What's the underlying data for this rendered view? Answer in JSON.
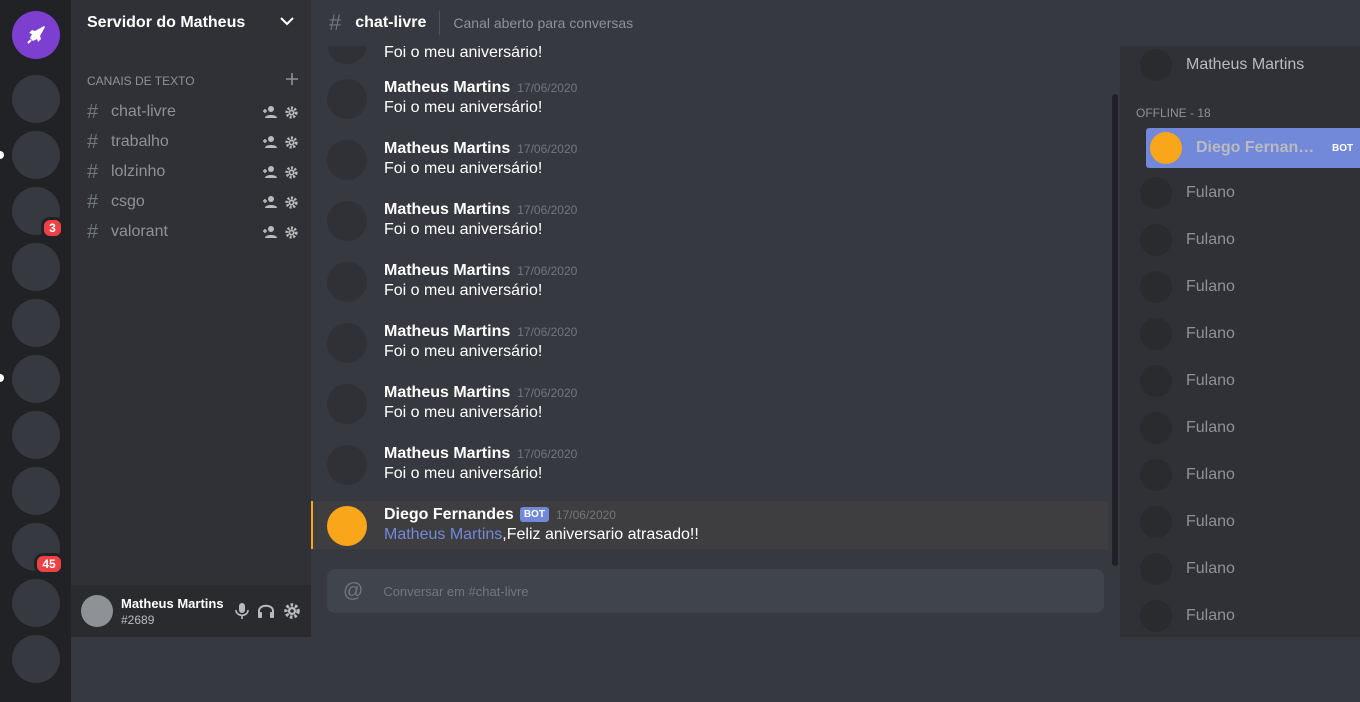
{
  "server": {
    "name": "Servidor do Matheus"
  },
  "sidebar": {
    "category": "CANAIS DE TEXTO",
    "channels": [
      {
        "name": "chat-livre"
      },
      {
        "name": "trabalho"
      },
      {
        "name": "lolzinho"
      },
      {
        "name": "csgo"
      },
      {
        "name": "valorant"
      }
    ]
  },
  "rail": {
    "badges": [
      "3",
      "45"
    ]
  },
  "user": {
    "name": "Matheus Martins",
    "tag": "#2689"
  },
  "header": {
    "channel": "chat-livre",
    "topic": "Canal aberto para conversas"
  },
  "messages": {
    "partial": "Foi o meu aniversário!",
    "items": [
      {
        "author": "Matheus Martins",
        "time": "17/06/2020",
        "text": "Foi o meu aniversário!"
      },
      {
        "author": "Matheus Martins",
        "time": "17/06/2020",
        "text": "Foi o meu aniversário!"
      },
      {
        "author": "Matheus Martins",
        "time": "17/06/2020",
        "text": "Foi o meu aniversário!"
      },
      {
        "author": "Matheus Martins",
        "time": "17/06/2020",
        "text": "Foi o meu aniversário!"
      },
      {
        "author": "Matheus Martins",
        "time": "17/06/2020",
        "text": "Foi o meu aniversário!"
      },
      {
        "author": "Matheus Martins",
        "time": "17/06/2020",
        "text": "Foi o meu aniversário!"
      },
      {
        "author": "Matheus Martins",
        "time": "17/06/2020",
        "text": "Foi o meu aniversário!"
      }
    ],
    "bot_message": {
      "author": "Diego Fernandes",
      "badge": "BOT",
      "time": "17/06/2020",
      "mention": "Matheus Martins",
      "text": ",Feliz aniversario atrasado!!"
    }
  },
  "composer": {
    "placeholder": "Conversar em #chat-livre"
  },
  "members": {
    "online_top": "Matheus Martins",
    "offline_header": "OFFLINE - 18",
    "bot": {
      "name": "Diego Fernandes",
      "badge": "BOT"
    },
    "list": [
      "Fulano",
      "Fulano",
      "Fulano",
      "Fulano",
      "Fulano",
      "Fulano",
      "Fulano",
      "Fulano",
      "Fulano",
      "Fulano"
    ]
  },
  "colors": {
    "accent": "#7289da",
    "brand": "#7c3fd0",
    "bot_avatar": "#faa61a",
    "alert": "#ed4245"
  }
}
